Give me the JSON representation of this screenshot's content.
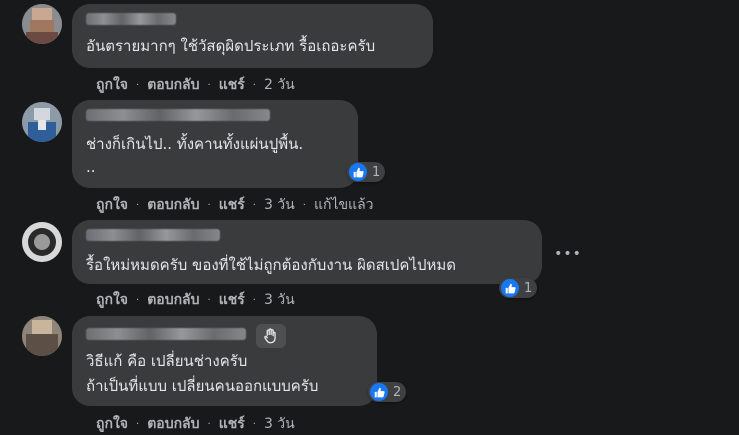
{
  "comments": [
    {
      "text_lines": [
        "อันตรายมากๆ ใช้วัสดุผิดประเภท รื้อเถอะครับ"
      ],
      "actions": {
        "like": "ถูกใจ",
        "reply": "ตอบกลับ",
        "share": "แชร์",
        "time": "2 วัน"
      }
    },
    {
      "text_lines": [
        "ช่างก็เกินไป.. ทั้งคานทั้งแผ่นปูพื้น.",
        ".."
      ],
      "reaction_count": "1",
      "actions": {
        "like": "ถูกใจ",
        "reply": "ตอบกลับ",
        "share": "แชร์",
        "time": "3 วัน",
        "edited": "แก้ไขแล้ว"
      }
    },
    {
      "text_lines": [
        "รื้อใหม่หมดครับ ของที่ใช้ไม่ถูกต้องกับงาน ผิดสเปคไปหมด"
      ],
      "reaction_count": "1",
      "more_label": "•••",
      "actions": {
        "like": "ถูกใจ",
        "reply": "ตอบกลับ",
        "share": "แชร์",
        "time": "3 วัน"
      }
    },
    {
      "text_lines": [
        "วิธีแก้ คือ เปลี่ยนช่างครับ",
        "ถ้าเป็นที่แบบ เปลี่ยนคนออกแบบครับ"
      ],
      "reaction_count": "2",
      "actions": {
        "like": "ถูกใจ",
        "reply": "ตอบกลับ",
        "share": "แชร์",
        "time": "3 วัน"
      }
    }
  ],
  "icons": {
    "reaction": "like-thumb-icon",
    "more": "more-options-icon",
    "badge": "waving-hand-icon"
  },
  "colors": {
    "background": "#18191a",
    "bubble": "#3a3b3c",
    "text": "#e4e6eb",
    "secondary": "#b0b3b8",
    "like_blue": "#1877f2"
  },
  "separator": "·"
}
